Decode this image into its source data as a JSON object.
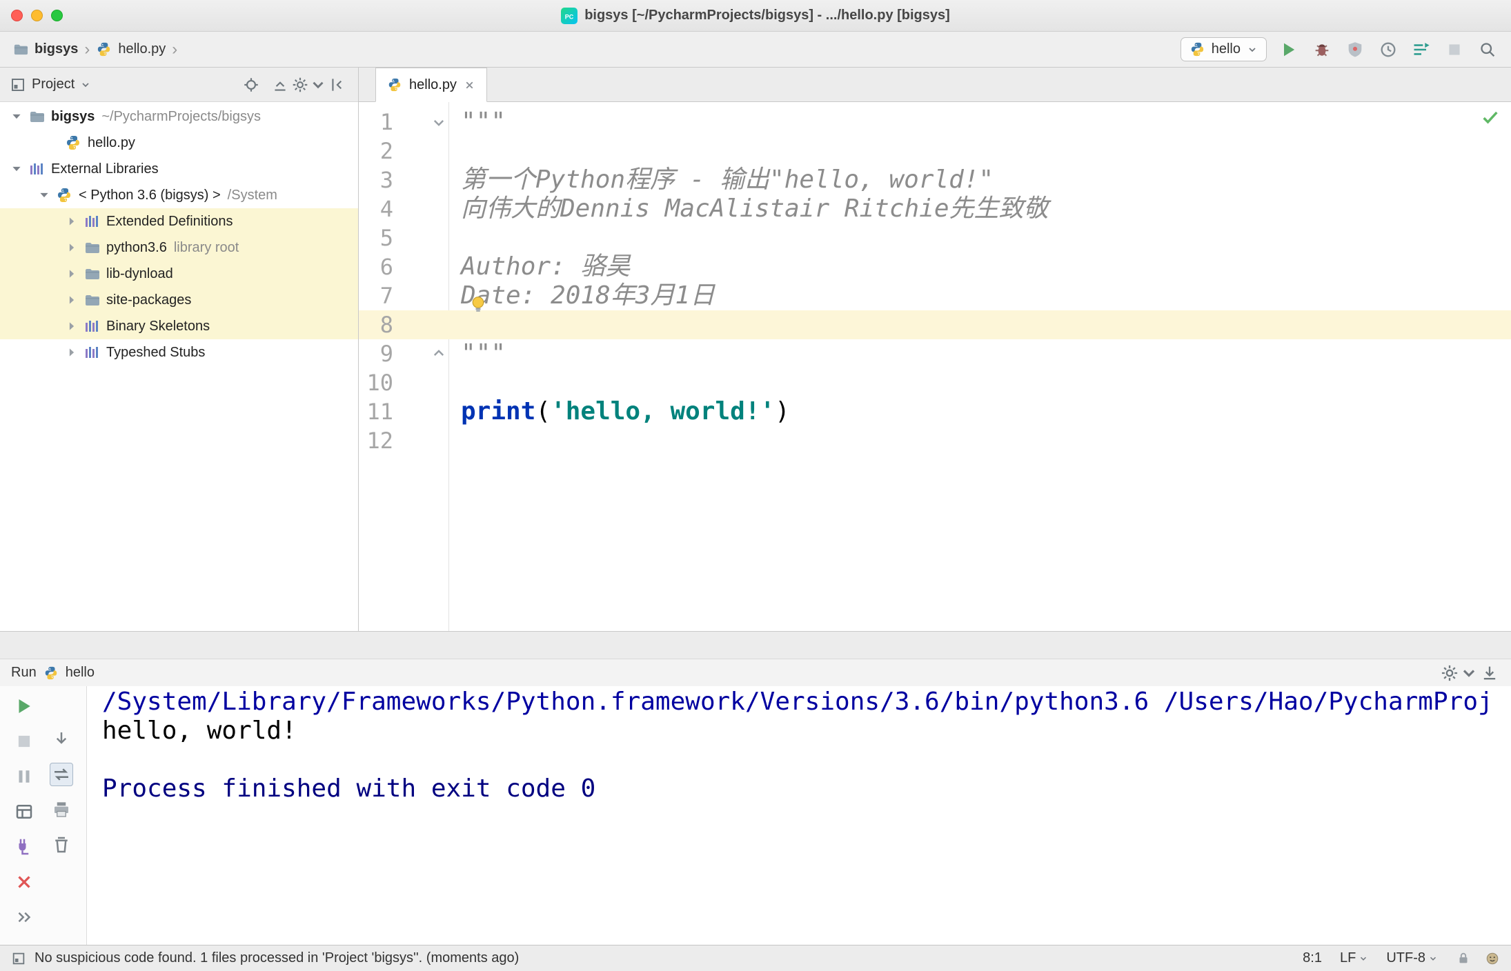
{
  "colors": {
    "c-kw": "#0033b3",
    "c-str": "#00827c",
    "c-doc": "#8c8c8c",
    "c-cmd": "#0000a0",
    "c-info": "#000080",
    "caret-line": "#fdf6d8",
    "tree-highlight": "#fbf6d3"
  },
  "titlebar": {
    "title": "bigsys [~/PycharmProjects/bigsys] - .../hello.py [bigsys]"
  },
  "toolbar": {
    "breadcrumbs": [
      {
        "label": "bigsys"
      },
      {
        "label": "hello.py"
      }
    ],
    "run_config": {
      "label": "hello"
    },
    "actions": [
      {
        "name": "run",
        "icon": "run"
      },
      {
        "name": "debug",
        "icon": "debug"
      },
      {
        "name": "coverage",
        "icon": "coverage"
      },
      {
        "name": "profiler",
        "icon": "profiler"
      },
      {
        "name": "concurrency-diagram",
        "icon": "concurrency"
      },
      {
        "name": "stop",
        "icon": "stop",
        "disabled": true
      },
      {
        "name": "search-everywhere",
        "icon": "search"
      }
    ]
  },
  "project_panel": {
    "header": {
      "title": "Project",
      "actions": [
        {
          "name": "locate-file",
          "icon": "locate"
        },
        {
          "name": "collapse-all",
          "icon": "collapse-all"
        },
        {
          "name": "settings",
          "icon": "settings",
          "chevron": true
        },
        {
          "name": "hide-panel",
          "icon": "hide"
        }
      ]
    },
    "tree": [
      {
        "label": "bigsys",
        "detail": "~/PycharmProjects/bigsys",
        "icon": "folder",
        "arrow": "open",
        "indent": 0,
        "bold": true
      },
      {
        "label": "hello.py",
        "icon": "python",
        "arrow": "none",
        "indent": 2
      },
      {
        "label": "External Libraries",
        "icon": "library",
        "arrow": "open",
        "indent": 0
      },
      {
        "label": "< Python 3.6 (bigsys) >",
        "detail": "/System",
        "icon": "python",
        "arrow": "open",
        "indent": 1
      },
      {
        "label": "Extended Definitions",
        "icon": "library",
        "arrow": "closed",
        "indent": 2,
        "highlight": true
      },
      {
        "label": "python3.6",
        "detail": "library root",
        "icon": "folder",
        "arrow": "closed",
        "indent": 2,
        "highlight": true
      },
      {
        "label": "lib-dynload",
        "icon": "folder",
        "arrow": "closed",
        "indent": 2,
        "highlight": true
      },
      {
        "label": "site-packages",
        "icon": "folder",
        "arrow": "closed",
        "indent": 2,
        "highlight": true
      },
      {
        "label": "Binary Skeletons",
        "icon": "library",
        "arrow": "closed",
        "indent": 2,
        "highlight": true
      },
      {
        "label": "Typeshed Stubs",
        "icon": "library",
        "arrow": "closed",
        "indent": 2
      }
    ]
  },
  "editor": {
    "tab": {
      "label": "hello.py"
    },
    "lines": [
      {
        "n": 1,
        "fold": "top",
        "segments": [
          {
            "t": "\"\"\"",
            "c": "doc"
          }
        ]
      },
      {
        "n": 2,
        "segments": []
      },
      {
        "n": 3,
        "segments": [
          {
            "t": "第一个Python程序 - 输出\"hello, world!\"",
            "c": "doc"
          }
        ]
      },
      {
        "n": 4,
        "segments": [
          {
            "t": "向伟大的Dennis MacAlistair Ritchie先生致敬",
            "c": "doc"
          }
        ]
      },
      {
        "n": 5,
        "segments": []
      },
      {
        "n": 6,
        "segments": [
          {
            "t": "Author: 骆昊",
            "c": "doc"
          }
        ]
      },
      {
        "n": 7,
        "bulb": true,
        "segments": [
          {
            "t": "Date: 2018年3月1日",
            "c": "doc"
          }
        ]
      },
      {
        "n": 8,
        "current": true,
        "segments": []
      },
      {
        "n": 9,
        "fold": "bottom",
        "segments": [
          {
            "t": "\"\"\"",
            "c": "doc"
          }
        ]
      },
      {
        "n": 10,
        "segments": []
      },
      {
        "n": 11,
        "segments": [
          {
            "t": "print",
            "c": "kw"
          },
          {
            "t": "(",
            "c": "plain"
          },
          {
            "t": "'hello, world!'",
            "c": "str"
          },
          {
            "t": ")",
            "c": "plain"
          }
        ]
      },
      {
        "n": 12,
        "segments": []
      }
    ]
  },
  "run_panel": {
    "header": {
      "label": "Run",
      "config": "hello",
      "actions": [
        {
          "name": "settings",
          "icon": "settings",
          "chevron": true
        },
        {
          "name": "dock",
          "icon": "dock"
        }
      ]
    },
    "toolbar": {
      "col1": [
        {
          "name": "rerun",
          "icon": "rerun"
        },
        {
          "name": "stop",
          "icon": "stop",
          "disabled": true
        },
        {
          "name": "pause-output",
          "icon": "pause"
        },
        {
          "name": "restore-layout",
          "icon": "layout"
        },
        {
          "name": "attach-console",
          "icon": "attach"
        },
        {
          "name": "close",
          "icon": "close-red"
        },
        {
          "name": "more-actions",
          "icon": "more"
        }
      ],
      "col2": [
        {
          "name": "scroll-to-end",
          "icon": "scroll-down"
        },
        {
          "name": "soft-wrap",
          "icon": "swap",
          "selected": true
        },
        {
          "name": "print",
          "icon": "print"
        },
        {
          "name": "clear-all",
          "icon": "clear"
        }
      ]
    },
    "console_lines": [
      {
        "text": "/System/Library/Frameworks/Python.framework/Versions/3.6/bin/python3.6 /Users/Hao/PycharmProj",
        "style": "cmd"
      },
      {
        "text": "hello, world!",
        "style": "plain"
      },
      {
        "text": "",
        "style": "plain"
      },
      {
        "text": "Process finished with exit code 0",
        "style": "info"
      }
    ]
  },
  "status_bar": {
    "message": "No suspicious code found. 1 files processed in 'Project 'bigsys''. (moments ago)",
    "caret_position": "8:1",
    "line_separator": "LF",
    "encoding": "UTF-8",
    "right_icons": [
      {
        "name": "read-only-lock",
        "icon": "lock"
      },
      {
        "name": "highlighting-level",
        "icon": "hector"
      }
    ]
  }
}
